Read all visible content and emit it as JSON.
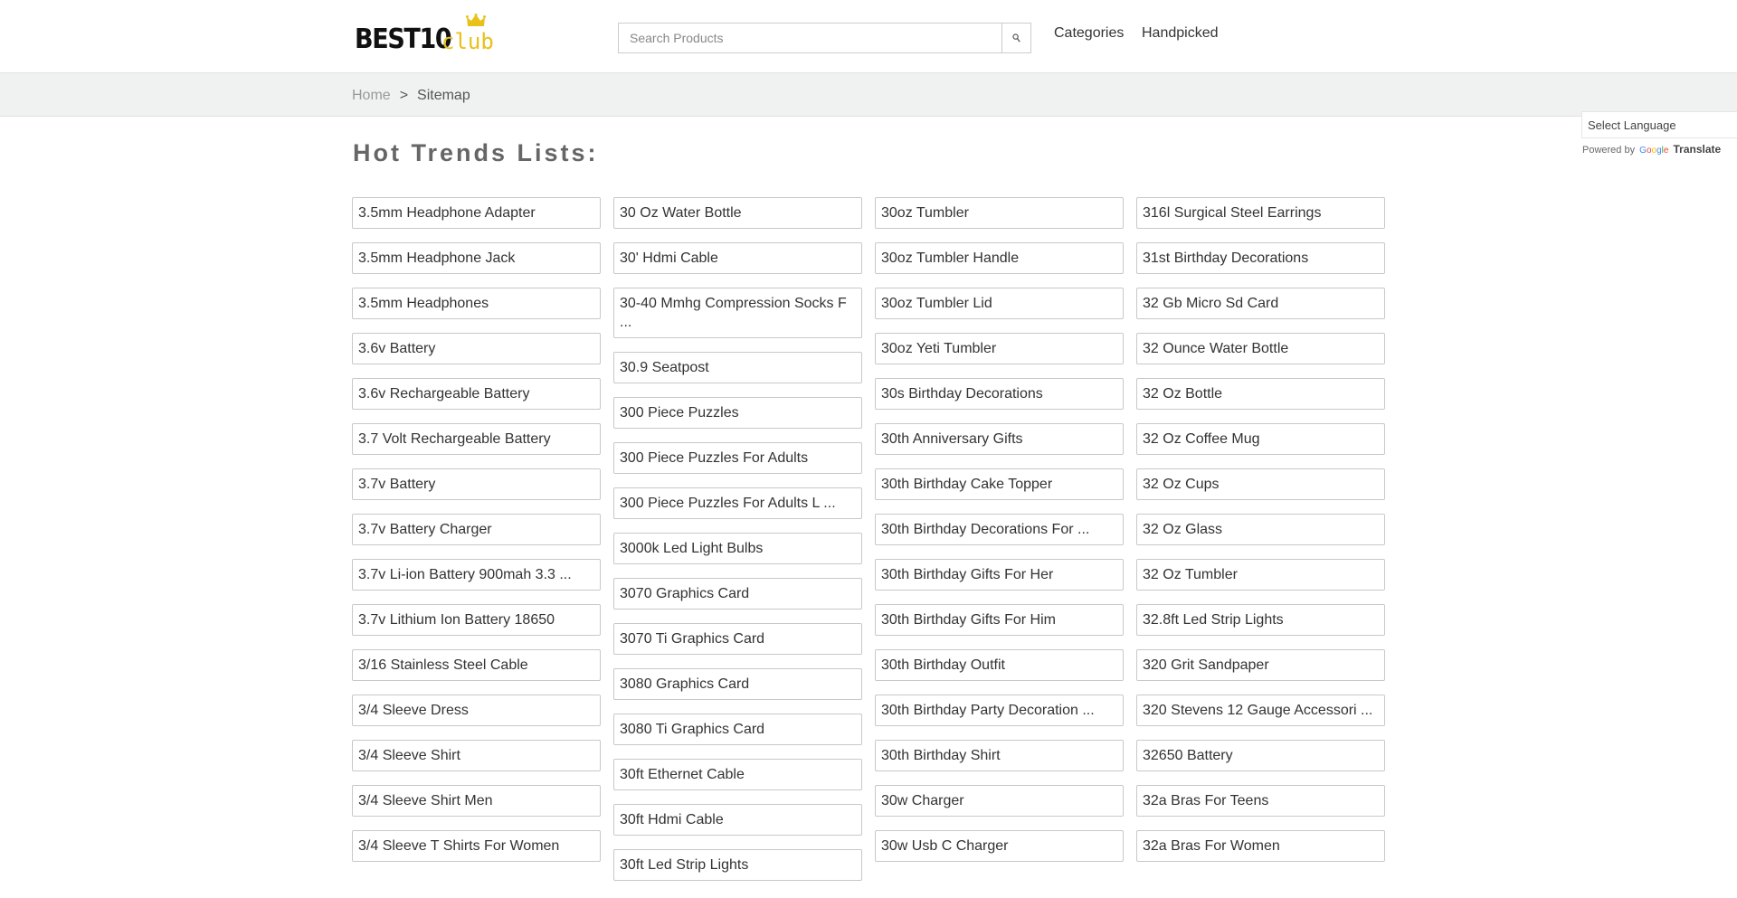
{
  "logo": {
    "main": "BEST10",
    "sub": "club"
  },
  "search": {
    "placeholder": "Search Products"
  },
  "nav": {
    "categories": "Categories",
    "handpicked": "Handpicked"
  },
  "breadcrumb": {
    "home": "Home",
    "separator": ">",
    "current": "Sitemap"
  },
  "translate": {
    "select_label": "Select Language",
    "powered_by": "Powered by",
    "translate_label": "Translate"
  },
  "heading": "Hot Trends Lists:",
  "columns": [
    [
      "3.5mm Headphone Adapter",
      "3.5mm Headphone Jack",
      "3.5mm Headphones",
      "3.6v Battery",
      "3.6v Rechargeable Battery",
      "3.7 Volt Rechargeable Battery",
      "3.7v Battery",
      "3.7v Battery Charger",
      "3.7v Li-ion Battery 900mah 3.3 ...",
      "3.7v Lithium Ion Battery 18650",
      "3/16 Stainless Steel Cable",
      "3/4 Sleeve Dress",
      "3/4 Sleeve Shirt",
      "3/4 Sleeve Shirt Men",
      "3/4 Sleeve T Shirts For Women"
    ],
    [
      "30 Oz Water Bottle",
      "30' Hdmi Cable",
      "30-40 Mmhg Compression Socks F\n...",
      "30.9 Seatpost",
      "300 Piece Puzzles",
      "300 Piece Puzzles For Adults",
      "300 Piece Puzzles For Adults L ...",
      "3000k Led Light Bulbs",
      "3070 Graphics Card",
      "3070 Ti Graphics Card",
      "3080 Graphics Card",
      "3080 Ti Graphics Card",
      "30ft Ethernet Cable",
      "30ft Hdmi Cable",
      "30ft Led Strip Lights"
    ],
    [
      "30oz Tumbler",
      "30oz Tumbler Handle",
      "30oz Tumbler Lid",
      "30oz Yeti Tumbler",
      "30s Birthday Decorations",
      "30th Anniversary Gifts",
      "30th Birthday Cake Topper",
      "30th Birthday Decorations For ...",
      "30th Birthday Gifts For Her",
      "30th Birthday Gifts For Him",
      "30th Birthday Outfit",
      "30th Birthday Party Decoration ...",
      "30th Birthday Shirt",
      "30w Charger",
      "30w Usb C Charger"
    ],
    [
      "316l Surgical Steel Earrings",
      "31st Birthday Decorations",
      "32 Gb Micro Sd Card",
      "32 Ounce Water Bottle",
      "32 Oz Bottle",
      "32 Oz Coffee Mug",
      "32 Oz Cups",
      "32 Oz Glass",
      "32 Oz Tumbler",
      "32.8ft Led Strip Lights",
      "320 Grit Sandpaper",
      "320 Stevens 12 Gauge Accessori ...",
      "32650 Battery",
      "32a Bras For Teens",
      "32a Bras For Women"
    ]
  ]
}
